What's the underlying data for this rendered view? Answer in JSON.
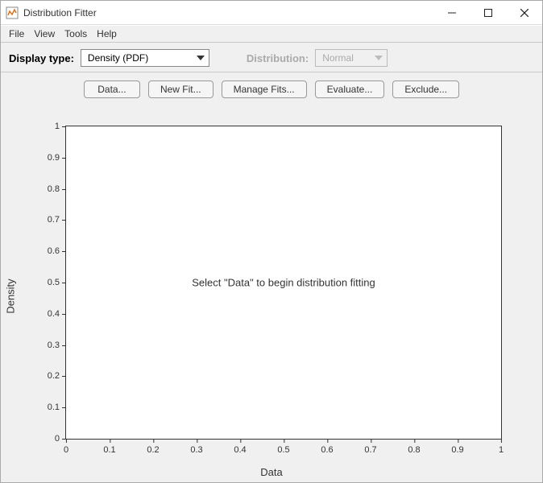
{
  "window": {
    "title": "Distribution Fitter"
  },
  "menubar": {
    "file": "File",
    "view": "View",
    "tools": "Tools",
    "help": "Help"
  },
  "toolbar": {
    "display_type_label": "Display type:",
    "display_type_value": "Density (PDF)",
    "distribution_label": "Distribution:",
    "distribution_value": "Normal"
  },
  "buttons": {
    "data": "Data...",
    "new_fit": "New Fit...",
    "manage_fits": "Manage Fits...",
    "evaluate": "Evaluate...",
    "exclude": "Exclude..."
  },
  "chart_data": {
    "type": "line",
    "title": "",
    "xlabel": "Data",
    "ylabel": "Density",
    "xlim": [
      0,
      1
    ],
    "ylim": [
      0,
      1
    ],
    "xticks": [
      0,
      0.1,
      0.2,
      0.3,
      0.4,
      0.5,
      0.6,
      0.7,
      0.8,
      0.9,
      1
    ],
    "yticks": [
      0,
      0.1,
      0.2,
      0.3,
      0.4,
      0.5,
      0.6,
      0.7,
      0.8,
      0.9,
      1
    ],
    "series": [],
    "message": "Select \"Data\" to begin distribution fitting"
  }
}
